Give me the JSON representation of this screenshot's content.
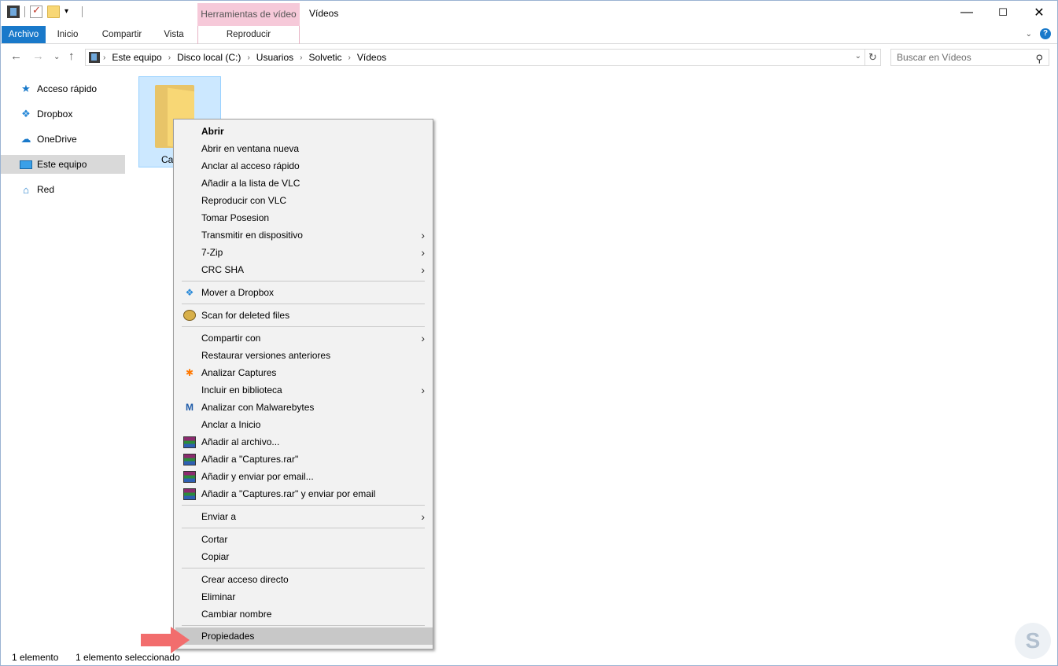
{
  "window": {
    "title": "Vídeos",
    "contextual_tab_group": "Herramientas de vídeo",
    "controls": {
      "minimize": "—",
      "maximize": "☐",
      "close": "✕"
    }
  },
  "ribbon": {
    "tabs": [
      "Archivo",
      "Inicio",
      "Compartir",
      "Vista"
    ],
    "contextual_tab": "Reproducir",
    "collapse_icon": "⌄",
    "help_icon": "?"
  },
  "address": {
    "crumbs": [
      "Este equipo",
      "Disco local (C:)",
      "Usuarios",
      "Solvetic",
      "Vídeos"
    ],
    "search_placeholder": "Buscar en Vídeos"
  },
  "navpane": {
    "items": [
      {
        "label": "Acceso rápido",
        "icon": "star-icon"
      },
      {
        "label": "Dropbox",
        "icon": "dropbox-icon"
      },
      {
        "label": "OneDrive",
        "icon": "cloud-icon"
      },
      {
        "label": "Este equipo",
        "icon": "computer-icon",
        "selected": true
      },
      {
        "label": "Red",
        "icon": "network-icon"
      }
    ]
  },
  "content": {
    "folder_label": "Ca"
  },
  "context_menu": {
    "items": [
      {
        "label": "Abrir"
      },
      {
        "label": "Abrir en ventana nueva"
      },
      {
        "label": "Anclar al acceso rápido"
      },
      {
        "label": "Añadir a la lista de VLC"
      },
      {
        "label": "Reproducir con VLC"
      },
      {
        "label": "Tomar Posesion"
      },
      {
        "label": "Transmitir en dispositivo"
      },
      {
        "label": "7-Zip"
      },
      {
        "label": "CRC SHA"
      },
      {
        "label": "Mover a Dropbox"
      },
      {
        "label": "Scan for deleted files"
      },
      {
        "label": "Compartir con"
      },
      {
        "label": "Restaurar versiones anteriores"
      },
      {
        "label": "Analizar Captures"
      },
      {
        "label": "Incluir en biblioteca"
      },
      {
        "label": "Analizar con Malwarebytes"
      },
      {
        "label": "Anclar a Inicio"
      },
      {
        "label": "Añadir al archivo..."
      },
      {
        "label": "Añadir a \"Captures.rar\""
      },
      {
        "label": "Añadir y enviar por email..."
      },
      {
        "label": "Añadir a \"Captures.rar\" y enviar por email"
      },
      {
        "label": "Enviar a"
      },
      {
        "label": "Cortar"
      },
      {
        "label": "Copiar"
      },
      {
        "label": "Crear acceso directo"
      },
      {
        "label": "Eliminar"
      },
      {
        "label": "Cambiar nombre"
      },
      {
        "label": "Propiedades",
        "highlighted": true
      }
    ]
  },
  "status": {
    "count": "1 elemento",
    "selected": "1 elemento seleccionado"
  },
  "colors": {
    "accent": "#1979ca",
    "contextual": "#f6c9d9",
    "selection": "#cce8ff",
    "pointer_arrow": "#f26d6d"
  }
}
